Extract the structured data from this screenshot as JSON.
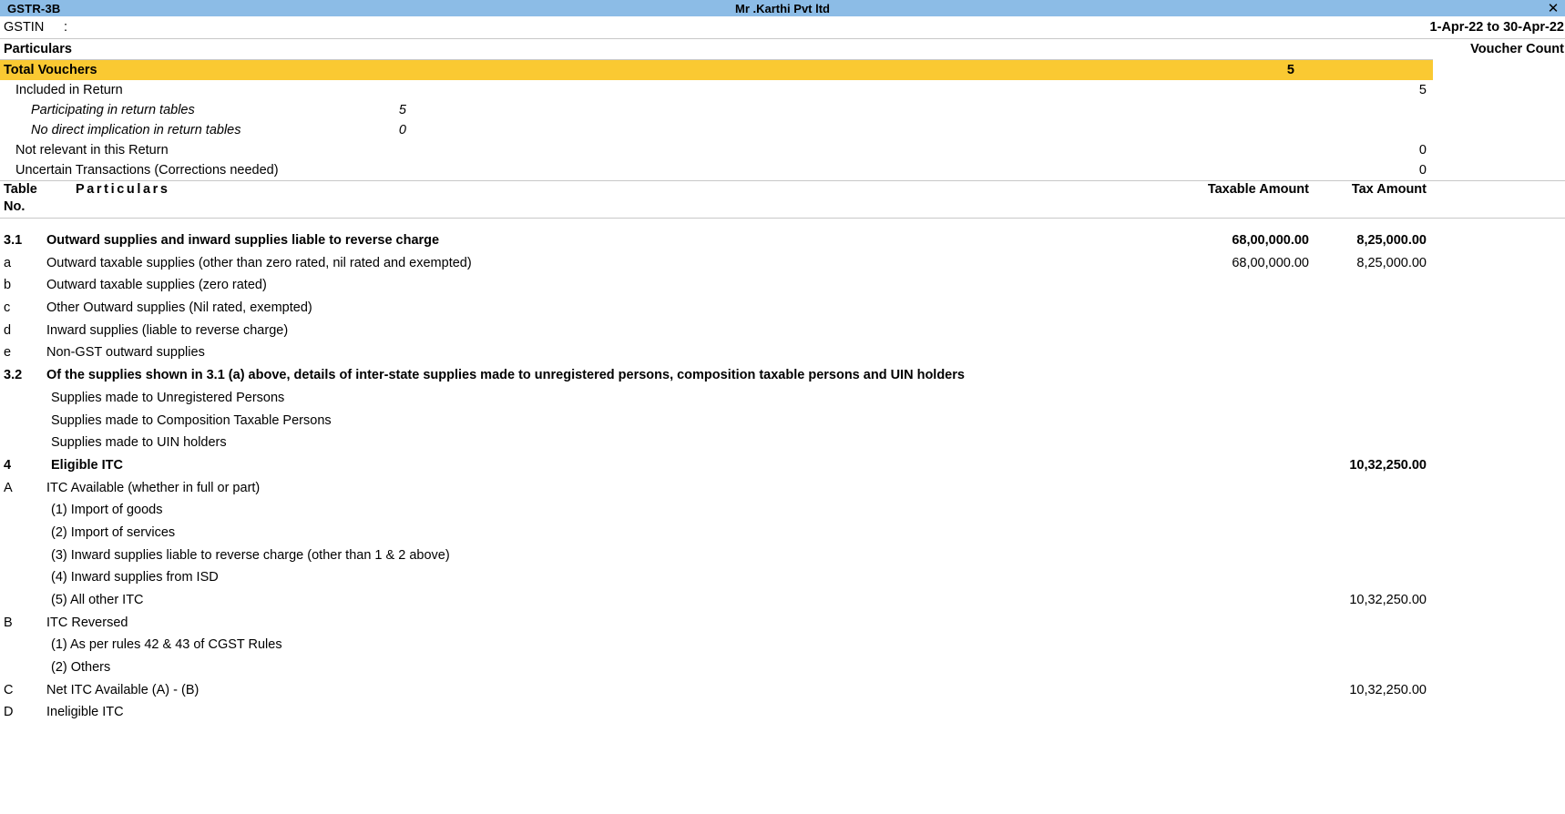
{
  "window": {
    "title": "GSTR-3B",
    "company": "Mr .Karthi Pvt ltd",
    "close_label": "✕",
    "titlebar_color": "#8cbce6",
    "highlight_color": "#fac932"
  },
  "header": {
    "gstin_label": "GSTIN",
    "gstin_colon": ":",
    "gstin_value": "",
    "period": "1-Apr-22 to 30-Apr-22"
  },
  "summary": {
    "col_particulars": "Particulars",
    "col_voucher_count": "Voucher Count",
    "rows": [
      {
        "label": "Total Vouchers",
        "mid": "",
        "count": "5",
        "style": "total"
      },
      {
        "label": "Included in Return",
        "mid": "",
        "count": "5",
        "style": "level1"
      },
      {
        "label": "Participating in return tables",
        "mid": "5",
        "count": "",
        "style": "italic"
      },
      {
        "label": "No direct implication in return tables",
        "mid": "0",
        "count": "",
        "style": "italic"
      },
      {
        "label": "Not relevant in this Return",
        "mid": "",
        "count": "0",
        "style": "level1"
      },
      {
        "label": "Uncertain Transactions (Corrections needed)",
        "mid": "",
        "count": "0",
        "style": "level1"
      }
    ]
  },
  "table": {
    "col_table_no_line1": "Table",
    "col_table_no_line2": "No.",
    "col_particulars": "Particulars",
    "col_taxable_amount": "Taxable Amount",
    "col_tax_amount": "Tax Amount",
    "rows": [
      {
        "no": "3.1",
        "particulars": "Outward supplies and inward supplies liable to reverse charge",
        "taxable": "68,00,000.00",
        "tax": "8,25,000.00",
        "indent": 0,
        "bold": true
      },
      {
        "no": "a",
        "particulars": "Outward taxable supplies (other than zero rated, nil rated and exempted)",
        "taxable": "68,00,000.00",
        "tax": "8,25,000.00",
        "indent": 0,
        "bold": false
      },
      {
        "no": "b",
        "particulars": "Outward taxable supplies (zero rated)",
        "taxable": "",
        "tax": "",
        "indent": 0,
        "bold": false
      },
      {
        "no": "c",
        "particulars": "Other Outward supplies (Nil rated, exempted)",
        "taxable": "",
        "tax": "",
        "indent": 0,
        "bold": false
      },
      {
        "no": "d",
        "particulars": "Inward supplies (liable to reverse charge)",
        "taxable": "",
        "tax": "",
        "indent": 0,
        "bold": false
      },
      {
        "no": "e",
        "particulars": "Non-GST outward supplies",
        "taxable": "",
        "tax": "",
        "indent": 0,
        "bold": false
      },
      {
        "no": "3.2",
        "particulars": "Of the supplies shown in 3.1 (a) above, details of inter-state supplies made to unregistered persons, composition taxable persons and UIN holders",
        "taxable": "",
        "tax": "",
        "indent": 0,
        "bold": true
      },
      {
        "no": "",
        "particulars": "Supplies made to Unregistered Persons",
        "taxable": "",
        "tax": "",
        "indent": 1,
        "bold": false
      },
      {
        "no": "",
        "particulars": "Supplies made to Composition Taxable Persons",
        "taxable": "",
        "tax": "",
        "indent": 1,
        "bold": false
      },
      {
        "no": "",
        "particulars": "Supplies made to UIN holders",
        "taxable": "",
        "tax": "",
        "indent": 1,
        "bold": false
      },
      {
        "no": "4",
        "particulars": "Eligible ITC",
        "taxable": "",
        "tax": "10,32,250.00",
        "indent": 1,
        "bold": true
      },
      {
        "no": "A",
        "particulars": "ITC Available (whether in full or part)",
        "taxable": "",
        "tax": "",
        "indent": 0,
        "bold": false
      },
      {
        "no": "",
        "particulars": "(1) Import of goods",
        "taxable": "",
        "tax": "",
        "indent": 1,
        "bold": false
      },
      {
        "no": "",
        "particulars": "(2) Import of services",
        "taxable": "",
        "tax": "",
        "indent": 1,
        "bold": false
      },
      {
        "no": "",
        "particulars": "(3) Inward supplies liable to reverse charge (other than 1 & 2 above)",
        "taxable": "",
        "tax": "",
        "indent": 1,
        "bold": false
      },
      {
        "no": "",
        "particulars": "(4) Inward supplies from ISD",
        "taxable": "",
        "tax": "",
        "indent": 1,
        "bold": false
      },
      {
        "no": "",
        "particulars": "(5) All other ITC",
        "taxable": "",
        "tax": "10,32,250.00",
        "indent": 1,
        "bold": false
      },
      {
        "no": "B",
        "particulars": "ITC Reversed",
        "taxable": "",
        "tax": "",
        "indent": 0,
        "bold": false
      },
      {
        "no": "",
        "particulars": "(1) As per rules 42 & 43 of CGST Rules",
        "taxable": "",
        "tax": "",
        "indent": 1,
        "bold": false
      },
      {
        "no": "",
        "particulars": "(2) Others",
        "taxable": "",
        "tax": "",
        "indent": 1,
        "bold": false
      },
      {
        "no": "C",
        "particulars": "Net ITC Available (A) - (B)",
        "taxable": "",
        "tax": "10,32,250.00",
        "indent": 0,
        "bold": false
      },
      {
        "no": "D",
        "particulars": "Ineligible ITC",
        "taxable": "",
        "tax": "",
        "indent": 0,
        "bold": false
      }
    ]
  }
}
